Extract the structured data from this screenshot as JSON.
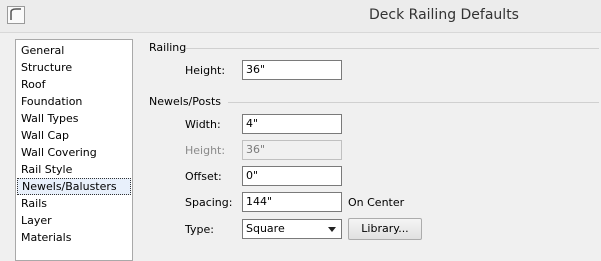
{
  "window": {
    "title": "Deck Railing Defaults"
  },
  "nav": {
    "items": [
      {
        "label": "General"
      },
      {
        "label": "Structure"
      },
      {
        "label": "Roof"
      },
      {
        "label": "Foundation"
      },
      {
        "label": "Wall Types"
      },
      {
        "label": "Wall Cap"
      },
      {
        "label": "Wall Covering"
      },
      {
        "label": "Rail Style"
      },
      {
        "label": "Newels/Balusters",
        "selected": true
      },
      {
        "label": "Rails"
      },
      {
        "label": "Layer"
      },
      {
        "label": "Materials"
      }
    ]
  },
  "railing": {
    "group_label": "Railing",
    "height_label": "Height:",
    "height_value": "36\""
  },
  "newels": {
    "group_label": "Newels/Posts",
    "width_label": "Width:",
    "width_value": "4\"",
    "height_label": "Height:",
    "height_value": "36\"",
    "offset_label": "Offset:",
    "offset_value": "0\"",
    "spacing_label": "Spacing:",
    "spacing_value": "144\"",
    "spacing_suffix": "On Center",
    "type_label": "Type:",
    "type_value": "Square",
    "library_button": "Library..."
  }
}
